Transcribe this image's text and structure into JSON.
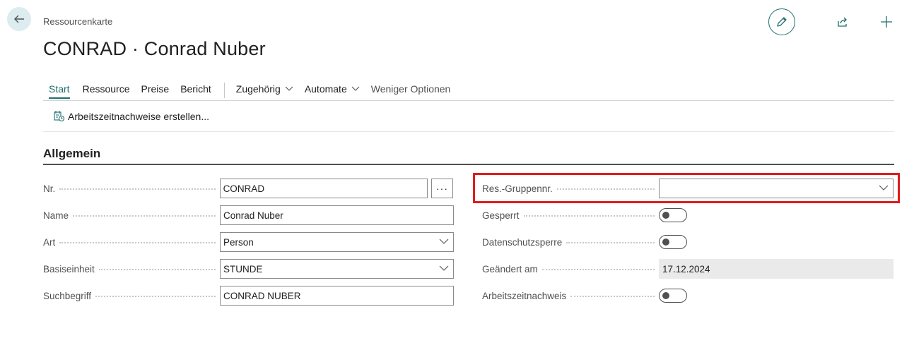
{
  "header": {
    "breadcrumb": "Ressourcenkarte",
    "title": "CONRAD · Conrad Nuber"
  },
  "actionbar": {
    "tabs": [
      "Start",
      "Ressource",
      "Preise",
      "Bericht"
    ],
    "dropdowns": [
      "Zugehörig",
      "Automate"
    ],
    "less_options": "Weniger Optionen",
    "sub_action": "Arbeitszeitnachweise erstellen..."
  },
  "section": {
    "title": "Allgemein"
  },
  "left_fields": [
    {
      "label": "Nr.",
      "value": "CONRAD"
    },
    {
      "label": "Name",
      "value": "Conrad Nuber"
    },
    {
      "label": "Art",
      "value": "Person"
    },
    {
      "label": "Basiseinheit",
      "value": "STUNDE"
    },
    {
      "label": "Suchbegriff",
      "value": "CONRAD NUBER"
    }
  ],
  "right_fields": [
    {
      "label": "Res.-Gruppennr.",
      "value": ""
    },
    {
      "label": "Gesperrt",
      "value": false
    },
    {
      "label": "Datenschutzsperre",
      "value": false
    },
    {
      "label": "Geändert am",
      "value": "17.12.2024"
    },
    {
      "label": "Arbeitszeitnachweis",
      "value": false
    }
  ],
  "colors": {
    "accent": "#1f6e6e",
    "highlight": "#e11b1b"
  },
  "icons": {
    "back": "arrow-left-icon",
    "edit": "pencil-icon",
    "share": "share-icon",
    "add": "plus-icon",
    "timesheet": "timesheet-icon"
  }
}
